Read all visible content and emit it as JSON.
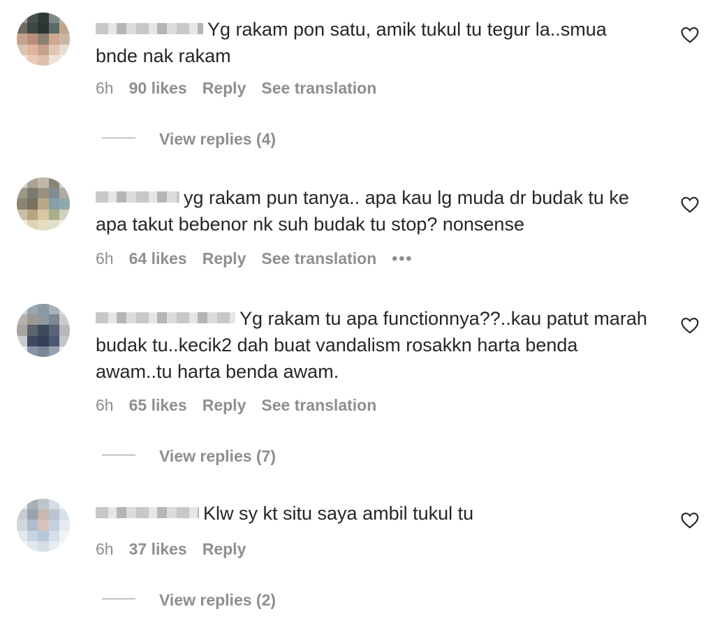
{
  "comments": [
    {
      "text": "Yg rakam pon satu, amik tukul tu tegur la..smua bnde nak rakam",
      "time": "6h",
      "likes": "90 likes",
      "reply": "Reply",
      "translate": "See translation",
      "more": "",
      "view_replies": "View replies (4)"
    },
    {
      "text": "yg rakam pun tanya.. apa kau lg muda dr budak tu ke apa takut bebenor nk suh budak tu stop? nonsense",
      "time": "6h",
      "likes": "64 likes",
      "reply": "Reply",
      "translate": "See translation",
      "more": "•••",
      "view_replies": ""
    },
    {
      "text": "Yg rakam tu apa functionnya??..kau patut marah budak tu..kecik2 dah buat vandalism rosakkn harta benda awam..tu harta benda awam.",
      "time": "6h",
      "likes": "65 likes",
      "reply": "Reply",
      "translate": "See translation",
      "more": "",
      "view_replies": "View replies (7)"
    },
    {
      "text": "Klw sy kt situ saya ambil tukul tu",
      "time": "6h",
      "likes": "37 likes",
      "reply": "Reply",
      "translate": "",
      "more": "",
      "view_replies": "View replies (2)"
    }
  ],
  "icons": {
    "like": "heart-outline-icon"
  },
  "colors": {
    "text": "#262626",
    "secondary": "#8e8e8e",
    "background": "#ffffff"
  }
}
